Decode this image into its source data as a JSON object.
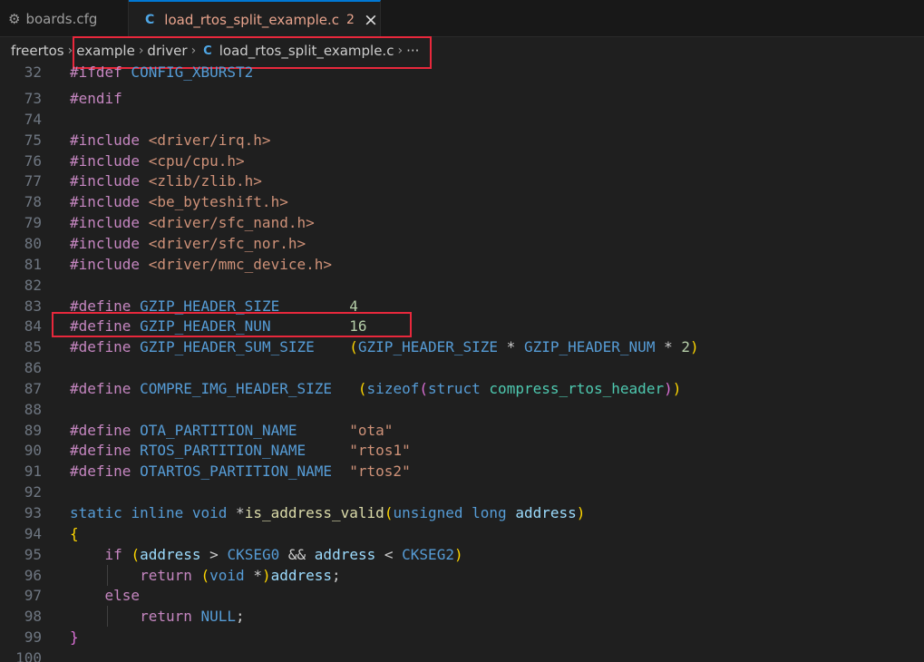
{
  "tabs": [
    {
      "label": "boards.cfg",
      "icon": "gear-icon"
    },
    {
      "label": "load_rtos_split_example.c",
      "icon": "c-file-icon",
      "problems": "2",
      "close": "×"
    }
  ],
  "breadcrumb": {
    "items": [
      "freertos",
      "example",
      "driver",
      "load_rtos_split_example.c"
    ],
    "more": "···",
    "file_icon": "C"
  },
  "editor": {
    "lines": [
      {
        "n": "32",
        "t": "#ifdef CONFIG_XBURST2"
      },
      {
        "n": "73",
        "t": "#endif"
      },
      {
        "n": "74",
        "t": ""
      },
      {
        "n": "75",
        "t": "#include <driver/irq.h>"
      },
      {
        "n": "76",
        "t": "#include <cpu/cpu.h>"
      },
      {
        "n": "77",
        "t": "#include <zlib/zlib.h>"
      },
      {
        "n": "78",
        "t": "#include <be_byteshift.h>"
      },
      {
        "n": "79",
        "t": "#include <driver/sfc_nand.h>"
      },
      {
        "n": "80",
        "t": "#include <driver/sfc_nor.h>"
      },
      {
        "n": "81",
        "t": "#include <driver/mmc_device.h>"
      },
      {
        "n": "82",
        "t": ""
      },
      {
        "n": "83",
        "t": "#define GZIP_HEADER_SIZE        4"
      },
      {
        "n": "84",
        "t": "#define GZIP_HEADER_NUN         16"
      },
      {
        "n": "85",
        "t": "#define GZIP_HEADER_SUM_SIZE    (GZIP_HEADER_SIZE * GZIP_HEADER_NUM * 2)"
      },
      {
        "n": "86",
        "t": ""
      },
      {
        "n": "87",
        "t": "#define COMPRE_IMG_HEADER_SIZE   (sizeof(struct compress_rtos_header))"
      },
      {
        "n": "88",
        "t": ""
      },
      {
        "n": "89",
        "t": "#define OTA_PARTITION_NAME      \"ota\""
      },
      {
        "n": "90",
        "t": "#define RTOS_PARTITION_NAME     \"rtos1\""
      },
      {
        "n": "91",
        "t": "#define OTARTOS_PARTITION_NAME  \"rtos2\""
      },
      {
        "n": "92",
        "t": ""
      },
      {
        "n": "93",
        "t": "static inline void *is_address_valid(unsigned long address)"
      },
      {
        "n": "94",
        "t": "{"
      },
      {
        "n": "95",
        "t": "    if (address > CKSEG0 && address < CKSEG2)"
      },
      {
        "n": "96",
        "t": "        return (void *)address;"
      },
      {
        "n": "97",
        "t": "    else"
      },
      {
        "n": "98",
        "t": "        return NULL;"
      },
      {
        "n": "99",
        "t": "}"
      },
      {
        "n": "100",
        "t": ""
      }
    ]
  },
  "colors": {
    "highlight_box": "#e8283c",
    "keyword": "#569cd6",
    "control": "#c586c0",
    "number": "#b5cea8",
    "string": "#ce9178",
    "function": "#dcdcaa",
    "variable": "#9cdcfe",
    "type": "#4ec9b0"
  }
}
